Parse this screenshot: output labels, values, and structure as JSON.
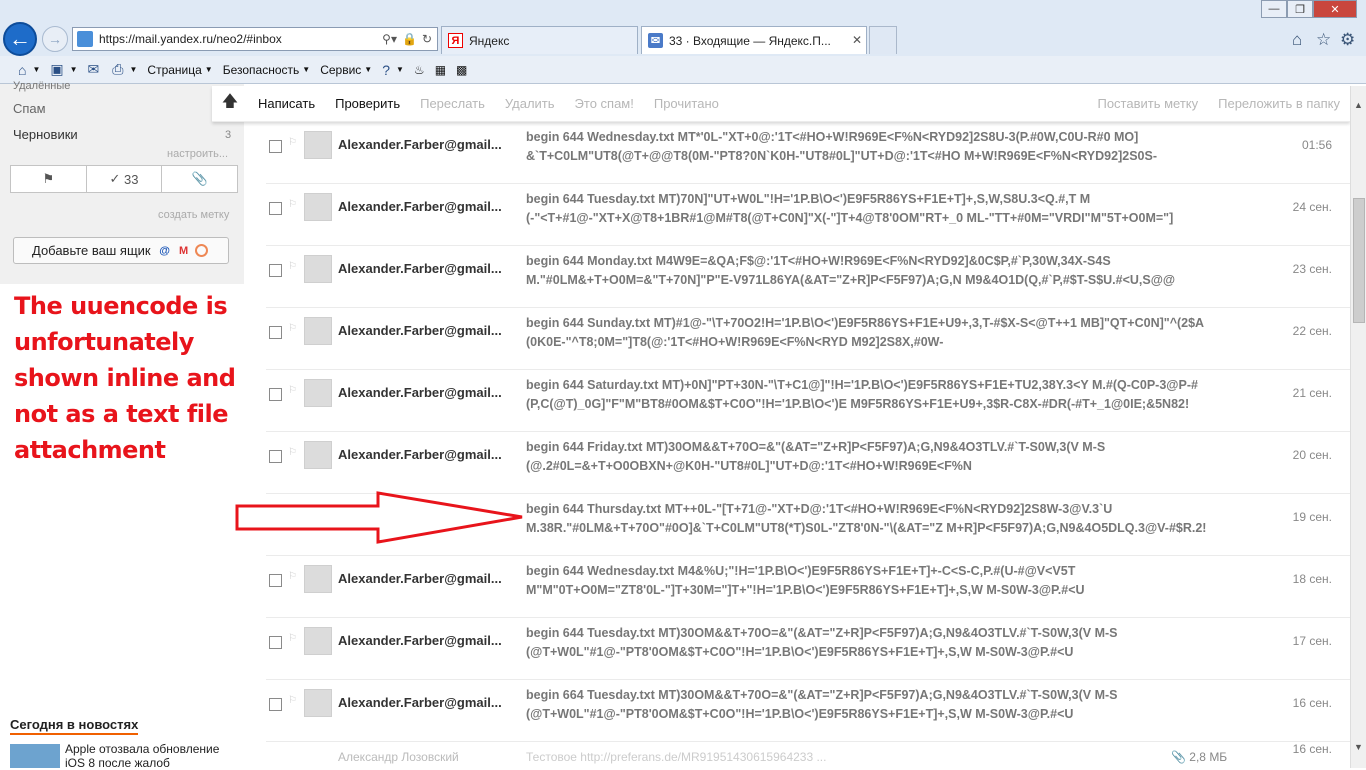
{
  "browser": {
    "url": "https://mail.yandex.ru/neo2/#inbox",
    "tabs": [
      {
        "label": "Яндекс",
        "icon": "yandex-icon"
      },
      {
        "label": "33 · Входящие — Яндекс.П...",
        "icon": "mail-icon"
      }
    ],
    "window_buttons": {
      "minimize": "—",
      "maximize": "❐",
      "close": "✕"
    },
    "commandbar": {
      "page": "Страница",
      "security": "Безопасность",
      "service": "Сервис"
    }
  },
  "sidebar": {
    "deleted": "Удалённые",
    "spam": "Спам",
    "drafts": "Черновики",
    "drafts_count": "3",
    "settings_link": "настроить...",
    "filter_count": "33",
    "create_label": "создать метку",
    "add_box_button": "Добавьте ваш ящик",
    "news_title": "Сегодня в новостях",
    "news_text": "Apple отозвала обновление iOS 8 после жалоб"
  },
  "annotation": "The uuencode is unfortunately shown inline and not as a text file attachment",
  "toolbar": {
    "compose": "Написать",
    "check": "Проверить",
    "forward": "Переслать",
    "delete": "Удалить",
    "spam": "Это спам!",
    "read": "Прочитано",
    "label": "Поставить метку",
    "move": "Переложить в папку"
  },
  "messages": [
    {
      "sender": "Alexander.Farber@gmail...",
      "line1": "begin 644 Wednesday.txt MT*'0L-\"XT+0@:'1T<#HO+W!R969E<F%N<RYD92]2S8U-3(P.#0W,C0U-R#0 MO]",
      "line2": "&`T+C0LM\"UT8(@T+@@T8(0M-\"PT8?0N`K0H-\"UT8#0L]\"UT+D@:'1T<#HO M+W!R969E<F%N<RYD92]2S0S-",
      "date": "01:56"
    },
    {
      "sender": "Alexander.Farber@gmail...",
      "line1": "begin 644 Tuesday.txt MT)70N]\"UT+W0L\"!H='1P.B\\O<')E9F5R86YS+F1E+T]+,S,W,S8U.3<Q.#,T M",
      "line2": "(-\"<T+#1@-\"XT+X@T8+1BR#1@M#T8(@T+C0N]\"X(-\"]T+4@T8'0OM\"RT+_0 ML-\"TT+#0M=\"VRDI\"M\"5T+O0M=\"]",
      "date": "24 сен."
    },
    {
      "sender": "Alexander.Farber@gmail...",
      "line1": "begin 644 Monday.txt M4W9E=&QA;F$@:'1T<#HO+W!R969E<F%N<RYD92]&0C$P,#`P,30W,34X-S4S",
      "line2": "M.\"#0LM&+T+O0M=&\"T+70N]\"P\"E-V971L86YA(&AT=\"Z+R]P<F5F97)A;G,N M9&4O1D(Q,#`P,#$T-S$U.#<U,S@@",
      "date": "23 сен."
    },
    {
      "sender": "Alexander.Farber@gmail...",
      "line1": "begin 644 Sunday.txt MT)#1@-\"\\T+70O2!H='1P.B\\O<')E9F5R86YS+F1E+U9+,3,T-#$X-S<@T++1 MB]\"QT+C0N]\"^(2$A",
      "line2": "(0K0E-\"^T8;0M=\"]T8(@:'1T<#HO+W!R969E<F%N<RYD M92]2S8X,#0W-",
      "date": "22 сен."
    },
    {
      "sender": "Alexander.Farber@gmail...",
      "line1": "begin 644 Saturday.txt MT)+0N]\"PT+30N-\"\\T+C1@]\"!H='1P.B\\O<')E9F5R86YS+F1E+TU2,38Y.3<Y M.#(Q-C0P-3@P-#",
      "line2": "(P,C(@T)_0G]\"F\"M\"BT8#0OM&$T+C0O\"!H='1P.B\\O<')E M9F5R86YS+F1E+U9+,3$R-C8X-#DR(-#T+_1@0IE;&5N82!",
      "date": "21 сен."
    },
    {
      "sender": "Alexander.Farber@gmail...",
      "line1": "begin 644 Friday.txt MT)30OM&&T+70O=&\"(&AT=\"Z+R]P<F5F97)A;G,N9&4O3TLV.#`T-S0W,3(V M-S",
      "line2": "(@.2#0L=&+T+O0OBXN+@K0H-\"UT8#0L]\"UT+D@:'1T<#HO+W!R969E<F%N",
      "date": "20 сен."
    },
    {
      "sender": "",
      "line1": "begin 644 Thursday.txt MT++0L-\"[T+71@-\"XT+D@:'1T<#HO+W!R969E<F%N<RYD92]2S8W-3@V.3`U",
      "line2": "M.38R.\"#0LM&+T+70O\"#0O]&`T+C0LM\"UT8(*T)S0L-\"ZT8'0N-\"\\(&AT=\"Z M+R]P<F5F97)A;G,N9&4O5DLQ.3@V-#$R.2!",
      "date": "19 сен."
    },
    {
      "sender": "Alexander.Farber@gmail...",
      "line1": "begin 644 Wednesday.txt M4&%U;\"!H='1P.B\\O<')E9F5R86YS+F1E+T]+-C<S-C,P.#(U-#@V<V5T",
      "line2": "M\"M\"0T+O0M=\"ZT8'0L-\"]T+30M=\"]T+\"!H='1P.B\\O<')E9F5R86YS+F1E+T]+,S,W M-S0W-3@P.#<U",
      "date": "18 сен."
    },
    {
      "sender": "Alexander.Farber@gmail...",
      "line1": "begin 644 Tuesday.txt MT)30OM&&T+70O=&\"(&AT=\"Z+R]P<F5F97)A;G,N9&4O3TLV.#`T-S0W,3(V M-S",
      "line2": "(@T+W0L\"#1@-\"PT8'0OM&$T+C0O\"!H='1P.B\\O<')E9F5R86YS+F1E+T]+,S,W M-S0W-3@P.#<U",
      "date": "17 сен."
    },
    {
      "sender": "Alexander.Farber@gmail...",
      "line1": "begin 664 Tuesday.txt MT)30OM&&T+70O=&\"(&AT=\"Z+R]P<F5F97)A;G,N9&4O3TLV.#`T-S0W,3(V M-S",
      "line2": "(@T+W0L\"#1@-\"PT8'0OM&$T+C0O\"!H='1P.B\\O<')E9F5R86YS+F1E+T]+,S,W M-S0W-3@P.#<U",
      "date": "16 сен."
    }
  ],
  "last_row": {
    "sender": "Александр Лозовский",
    "subject": "Тестовое http://preferans.de/MR91951430615964233 ...",
    "size": "2,8 МБ",
    "date": "16 сен."
  },
  "colors": {
    "annotation": "#e8141b",
    "accent": "#1e6cc9"
  }
}
